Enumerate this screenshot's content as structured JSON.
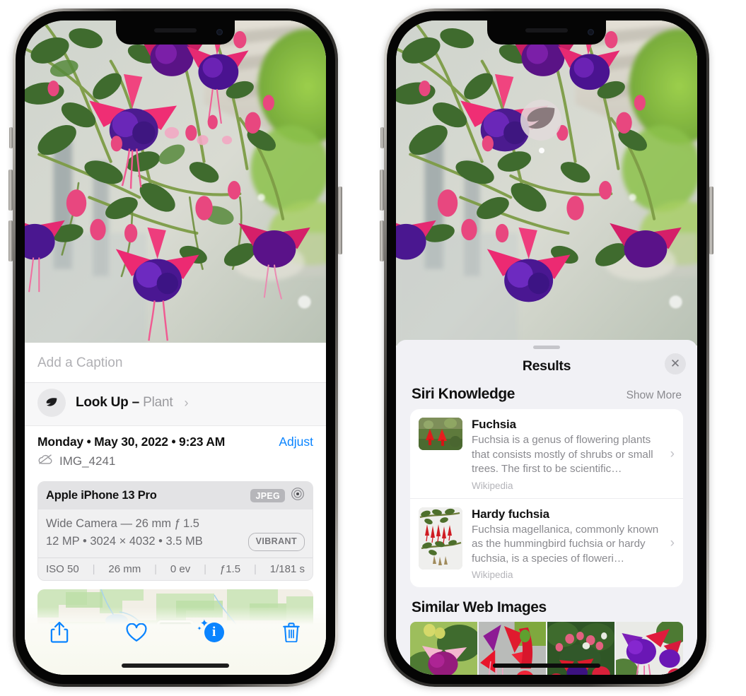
{
  "left_phone": {
    "photo": {
      "alt": "fuchsia-flowers-photo"
    },
    "caption_placeholder": "Add a Caption",
    "lookup": {
      "icon": "leaf-icon",
      "label": "Look Up – ",
      "subject": "Plant",
      "chevron": "›"
    },
    "metadata": {
      "date": "Monday • May 30, 2022 • 9:23 AM",
      "adjust_label": "Adjust",
      "cloud_icon": "icloud-slash-icon",
      "filename": "IMG_4241"
    },
    "camera_card": {
      "device": "Apple iPhone 13 Pro",
      "format_badge": "JPEG",
      "aperture_icon": "aperture-icon",
      "lens_line": "Wide Camera — 26 mm ƒ 1.5",
      "specs_line": "12 MP • 3024 × 4032 • 3.5 MB",
      "style_badge": "VIBRANT",
      "exif": [
        "ISO 50",
        "26 mm",
        "0 ev",
        "ƒ1.5",
        "1/181 s"
      ]
    },
    "map": {
      "alt": "location-map-strip",
      "pin_alt": "photo-pin-thumbnail"
    },
    "toolbar": [
      {
        "name": "share-button",
        "icon": "share-icon"
      },
      {
        "name": "favorite-button",
        "icon": "heart-icon"
      },
      {
        "name": "info-button",
        "icon": "info-sparkle-icon",
        "glyph": "i"
      },
      {
        "name": "delete-button",
        "icon": "trash-icon"
      }
    ]
  },
  "right_phone": {
    "photo": {
      "alt": "fuchsia-flowers-photo"
    },
    "leaf_badge": {
      "icon": "leaf-icon"
    },
    "sheet": {
      "title": "Results",
      "close_label": "✕",
      "sections": [
        {
          "title": "Siri Knowledge",
          "action": "Show More",
          "items": [
            {
              "title": "Fuchsia",
              "description": "Fuchsia is a genus of flowering plants that consists mostly of shrubs or small trees. The first to be scientific…",
              "source": "Wikipedia",
              "thumb": "fuchsia-red-flowers-thumb",
              "chevron": "›"
            },
            {
              "title": "Hardy fuchsia",
              "description": "Fuchsia magellanica, commonly known as the hummingbird fuchsia or hardy fuchsia, is a species of floweri…",
              "source": "Wikipedia",
              "thumb": "hardy-fuchsia-branch-thumb",
              "chevron": "›"
            }
          ]
        },
        {
          "title": "Similar Web Images",
          "images": [
            {
              "alt": "similar-image-1-magenta-fuchsia-leaves"
            },
            {
              "alt": "similar-image-2-red-fuchsia-closeup"
            },
            {
              "alt": "similar-image-3-fuchsia-bush"
            },
            {
              "alt": "similar-image-4-purple-red-fuchsia"
            }
          ]
        }
      ]
    }
  },
  "colors": {
    "accent_blue": "#0a84ff",
    "sheet_bg": "#f1f1f5",
    "card_bg": "#ffffff",
    "muted_text": "#8a8a8f"
  }
}
